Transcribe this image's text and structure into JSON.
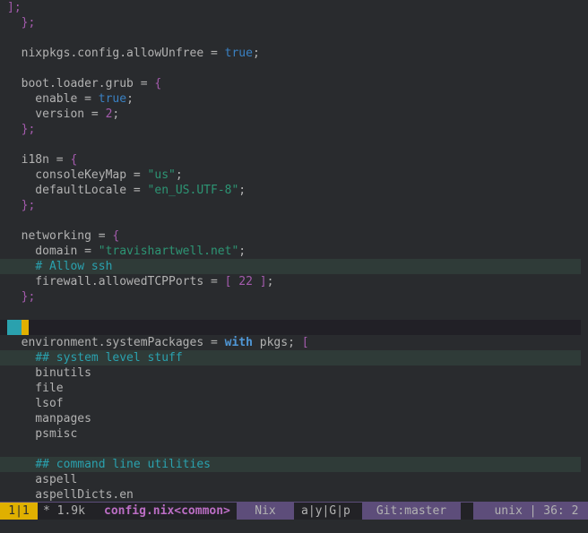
{
  "editor": {
    "lines": [
      {
        "type": "plain",
        "tokens": [
          [
            "brace",
            "];"
          ]
        ]
      },
      {
        "type": "plain",
        "tokens": [
          [
            "plain",
            "  "
          ],
          [
            "brace",
            "};"
          ]
        ]
      },
      {
        "type": "plain",
        "tokens": []
      },
      {
        "type": "plain",
        "tokens": [
          [
            "plain",
            "  nixpkgs.config.allowUnfree = "
          ],
          [
            "const",
            "true"
          ],
          [
            "plain",
            ";"
          ]
        ]
      },
      {
        "type": "plain",
        "tokens": []
      },
      {
        "type": "plain",
        "tokens": [
          [
            "plain",
            "  boot.loader.grub = "
          ],
          [
            "brace",
            "{"
          ]
        ]
      },
      {
        "type": "plain",
        "tokens": [
          [
            "plain",
            "    enable = "
          ],
          [
            "const",
            "true"
          ],
          [
            "plain",
            ";"
          ]
        ]
      },
      {
        "type": "plain",
        "tokens": [
          [
            "plain",
            "    version = "
          ],
          [
            "num",
            "2"
          ],
          [
            "plain",
            ";"
          ]
        ]
      },
      {
        "type": "plain",
        "tokens": [
          [
            "plain",
            "  "
          ],
          [
            "brace",
            "};"
          ]
        ]
      },
      {
        "type": "plain",
        "tokens": []
      },
      {
        "type": "plain",
        "tokens": [
          [
            "plain",
            "  i18n = "
          ],
          [
            "brace",
            "{"
          ]
        ]
      },
      {
        "type": "plain",
        "tokens": [
          [
            "plain",
            "    consoleKeyMap = "
          ],
          [
            "str",
            "\"us\""
          ],
          [
            "plain",
            ";"
          ]
        ]
      },
      {
        "type": "plain",
        "tokens": [
          [
            "plain",
            "    defaultLocale = "
          ],
          [
            "str",
            "\"en_US.UTF-8\""
          ],
          [
            "plain",
            ";"
          ]
        ]
      },
      {
        "type": "plain",
        "tokens": [
          [
            "plain",
            "  "
          ],
          [
            "brace",
            "};"
          ]
        ]
      },
      {
        "type": "plain",
        "tokens": []
      },
      {
        "type": "plain",
        "tokens": [
          [
            "plain",
            "  networking = "
          ],
          [
            "brace",
            "{"
          ]
        ]
      },
      {
        "type": "plain",
        "tokens": [
          [
            "plain",
            "    domain = "
          ],
          [
            "str",
            "\"travishartwell.net\""
          ],
          [
            "plain",
            ";"
          ]
        ]
      },
      {
        "type": "comment",
        "tokens": [
          [
            "plain",
            "    "
          ],
          [
            "cmt",
            "# Allow ssh"
          ]
        ]
      },
      {
        "type": "plain",
        "tokens": [
          [
            "plain",
            "    firewall.allowedTCPPorts = "
          ],
          [
            "brace",
            "["
          ],
          [
            "plain",
            " "
          ],
          [
            "num",
            "22"
          ],
          [
            "plain",
            " "
          ],
          [
            "brace",
            "]"
          ],
          [
            "plain",
            ";"
          ]
        ]
      },
      {
        "type": "plain",
        "tokens": [
          [
            "plain",
            "  "
          ],
          [
            "brace",
            "};"
          ]
        ]
      },
      {
        "type": "plain",
        "tokens": []
      },
      {
        "type": "cursor",
        "tokens": []
      },
      {
        "type": "plain",
        "tokens": [
          [
            "plain",
            "  environment.systemPackages = "
          ],
          [
            "kw",
            "with"
          ],
          [
            "plain",
            " pkgs; "
          ],
          [
            "brace",
            "["
          ]
        ]
      },
      {
        "type": "comment",
        "tokens": [
          [
            "plain",
            "    "
          ],
          [
            "cmt",
            "## system level stuff"
          ]
        ]
      },
      {
        "type": "plain",
        "tokens": [
          [
            "plain",
            "    binutils"
          ]
        ]
      },
      {
        "type": "plain",
        "tokens": [
          [
            "plain",
            "    file"
          ]
        ]
      },
      {
        "type": "plain",
        "tokens": [
          [
            "plain",
            "    lsof"
          ]
        ]
      },
      {
        "type": "plain",
        "tokens": [
          [
            "plain",
            "    manpages"
          ]
        ]
      },
      {
        "type": "plain",
        "tokens": [
          [
            "plain",
            "    psmisc"
          ]
        ]
      },
      {
        "type": "plain",
        "tokens": []
      },
      {
        "type": "comment",
        "tokens": [
          [
            "plain",
            "    "
          ],
          [
            "cmt",
            "## command line utilities"
          ]
        ]
      },
      {
        "type": "plain",
        "tokens": [
          [
            "plain",
            "    aspell"
          ]
        ]
      },
      {
        "type": "plain",
        "tokens": [
          [
            "plain",
            "    aspellDicts.en"
          ]
        ]
      }
    ]
  },
  "modeline": {
    "window_number": "1|1",
    "buffer_info": "* 1.9k",
    "buffer_name": "config.nix<common>",
    "major_mode": "Nix",
    "minor_modes": "a|y|G|p",
    "version_control": "Git:master",
    "encoding": "unix | 36: 2"
  },
  "colors": {
    "background": "#292b2e",
    "keyword": "#4f97d7",
    "string": "#2d9574",
    "comment": "#2aa1ae",
    "brace": "#a45bad",
    "cursor_teal": "#2aa1ae",
    "cursor_gold": "#e0b000"
  }
}
